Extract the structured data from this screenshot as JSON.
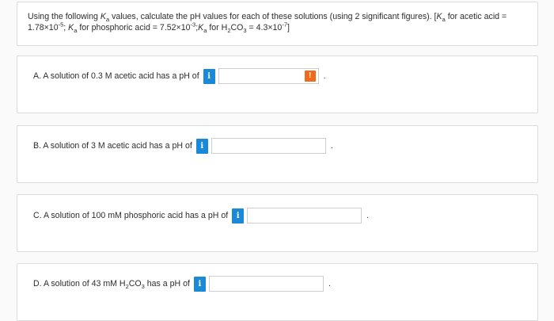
{
  "intro": {
    "p1": "Using the following ",
    "k": "K",
    "a": "a",
    "p2": " values, calculate the pH values for each of these solutions (using 2 significant figures). [",
    "p3": " for acetic acid =",
    "p4": "1.78×10",
    "exp1": "-5",
    "p5": "; ",
    "p6": " for phosphoric acid = 7.52×10",
    "exp2": "-3",
    "p7": ";",
    "p8": " for H",
    "sub2": "2",
    "p9": "CO",
    "sub3": "3",
    "p10": " = 4.3×10",
    "exp3": "-7",
    "p11": "]"
  },
  "questions": [
    {
      "label": "A. A solution of 0.3 M acetic acid has a pH of",
      "info_icon": "i",
      "value": "",
      "error_icon": "!",
      "suffix": "."
    },
    {
      "label": "B. A solution of 3 M acetic acid has a pH of",
      "info_icon": "i",
      "value": "",
      "suffix": "."
    },
    {
      "label": "C. A solution of 100 mM phosphoric acid has a pH of",
      "info_icon": "i",
      "value": "",
      "suffix": "."
    },
    {
      "label_pre": "D. A solution of 43 mM H",
      "label_sub1": "2",
      "label_mid": "CO",
      "label_sub2": "3",
      "label_post": " has a pH of",
      "info_icon": "i",
      "value": "",
      "suffix": "."
    }
  ],
  "colors": {
    "info_button": "#1a8ad8",
    "error_badge": "#f06a1b"
  }
}
